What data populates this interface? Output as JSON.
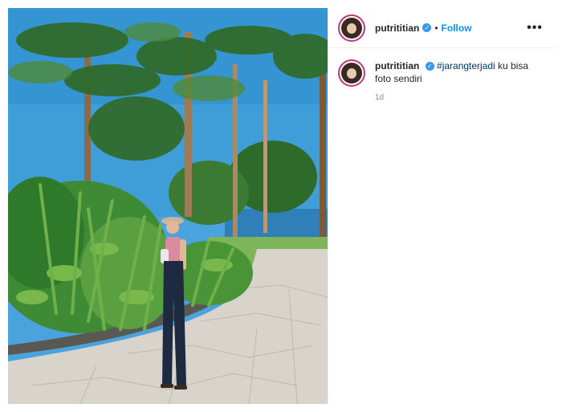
{
  "post": {
    "username": "putrititian",
    "follow_label": "Follow",
    "separator": "•",
    "more_label": "•••",
    "caption_hashtag": "#jarangterjadi",
    "caption_text": "ku bisa foto sendiri",
    "timestamp": "1d"
  },
  "colors": {
    "verified": "#3897f0",
    "follow": "#0095f6",
    "hashtag": "#00376b",
    "story_ring": "#c13584"
  },
  "icons": {
    "verified": "verified-badge-icon",
    "more": "more-options-icon"
  }
}
